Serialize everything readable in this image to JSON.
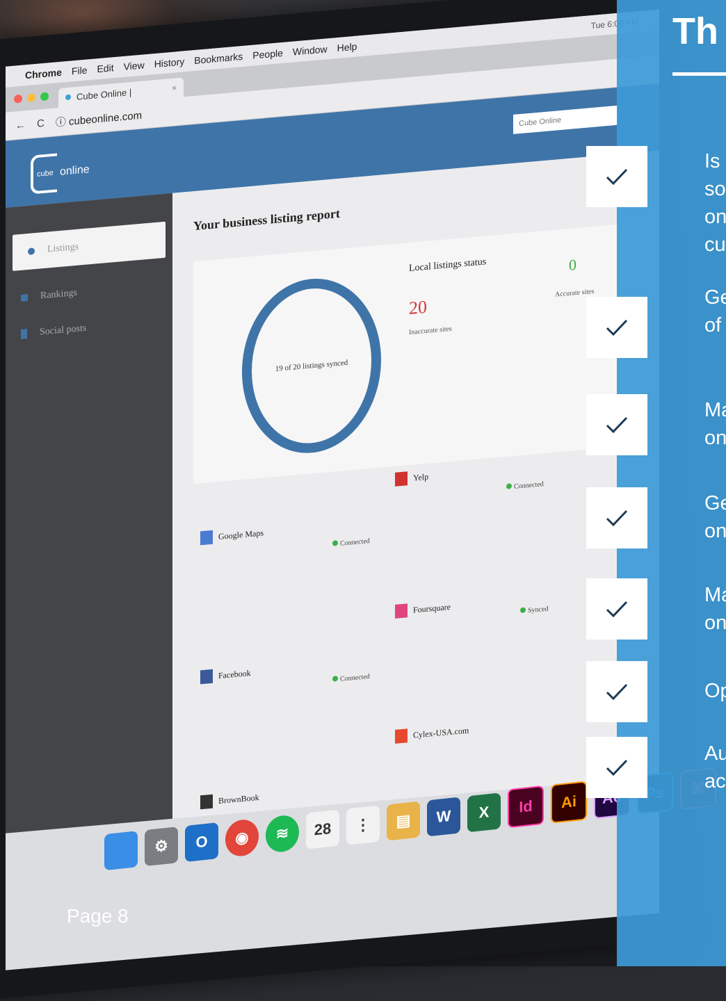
{
  "browser": {
    "menu_items": [
      "Chrome",
      "File",
      "Edit",
      "View",
      "History",
      "Bookmarks",
      "People",
      "Window",
      "Help"
    ],
    "status_text": "Tue 6:08 PM",
    "tab_title": "Cube Online |",
    "tab_close": "×",
    "nav_back": "←",
    "nav_reload": "C",
    "url": "ⓘ cubeonline.com"
  },
  "app": {
    "logo_text": "online",
    "logo_mark": "cube",
    "search_value": "Cube Online",
    "sidebar": [
      {
        "label": "Listings",
        "active": true
      },
      {
        "label": "Rankings",
        "active": false
      },
      {
        "label": "Social posts",
        "active": false
      }
    ],
    "report_title": "Your business listing report",
    "ring_label": "19 of 20 listings synced",
    "local_status_title": "Local listings status",
    "inaccurate_count": "20",
    "inaccurate_label": "Inaccurate sites",
    "accurate_count": "0",
    "accurate_label": "Accurate sites",
    "listings": [
      {
        "name": "Google Maps",
        "color": "#4a7bd0",
        "status": "Connected"
      },
      {
        "name": "Yelp",
        "color": "#d0322d",
        "status": "Connected"
      },
      {
        "name": "Foursquare",
        "color": "#e0457b",
        "status": "Synced"
      },
      {
        "name": "Facebook",
        "color": "#3b5998",
        "status": "Connected"
      },
      {
        "name": "Cylex-USA.com",
        "color": "#e6492d",
        "status": ""
      },
      {
        "name": "BrownBook",
        "color": "#333333",
        "status": ""
      }
    ]
  },
  "dock": [
    {
      "name": "finder",
      "glyph": "",
      "color": "#3a8ee6"
    },
    {
      "name": "system-preferences",
      "glyph": "⚙",
      "color": "#7a7d82"
    },
    {
      "name": "outlook",
      "glyph": "O",
      "color": "#1e6fc8"
    },
    {
      "name": "chrome",
      "glyph": "◉",
      "color": "#e2453a"
    },
    {
      "name": "spotify",
      "glyph": "≋",
      "color": "#1db954"
    },
    {
      "name": "calendar",
      "glyph": "28",
      "color": "#f2f2f2"
    },
    {
      "name": "reminders",
      "glyph": "⋮",
      "color": "#f2f2f2"
    },
    {
      "name": "notes",
      "glyph": "▤",
      "color": "#e9b34a"
    },
    {
      "name": "word",
      "glyph": "W",
      "color": "#2b579a"
    },
    {
      "name": "excel",
      "glyph": "X",
      "color": "#217346"
    },
    {
      "name": "indesign",
      "glyph": "Id",
      "color": "#49021f"
    },
    {
      "name": "illustrator",
      "glyph": "Ai",
      "color": "#330000"
    },
    {
      "name": "after-effects",
      "glyph": "Ae",
      "color": "#1f0740"
    },
    {
      "name": "photoshop",
      "glyph": "Ps",
      "color": "#001e36"
    },
    {
      "name": "acrobat",
      "glyph": "⌘",
      "color": "#3a0a0a"
    }
  ],
  "panel": {
    "title": "Th",
    "features": [
      {
        "line1": "Is",
        "line2": "so",
        "line3": "on",
        "line4": "cu"
      },
      {
        "line1": "Ge",
        "line2": "of"
      },
      {
        "line1": "Ma",
        "line2": "on"
      },
      {
        "line1": "Ge",
        "line2": "on"
      },
      {
        "line1": "Ma",
        "line2": "on"
      },
      {
        "line1": "Op"
      },
      {
        "line1": "Au",
        "line2": "ac"
      }
    ]
  },
  "page_label": "Page 8",
  "colors": {
    "panel_blue": "#3d9ad6",
    "app_blue": "#3f74a8",
    "check_color": "#1f3a52"
  }
}
